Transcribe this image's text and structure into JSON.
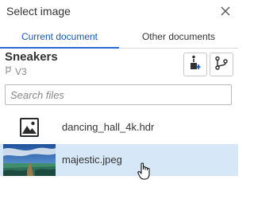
{
  "dialog": {
    "title": "Select image"
  },
  "tabs": [
    {
      "label": "Current document"
    },
    {
      "label": "Other documents"
    }
  ],
  "document": {
    "name": "Sneakers",
    "version": "V3"
  },
  "search": {
    "placeholder": "Search files",
    "value": ""
  },
  "files": [
    {
      "name": "dancing_hall_4k.hdr",
      "icon": "image-icon"
    },
    {
      "name": "majestic.jpeg",
      "icon": "image-thumbnail"
    }
  ],
  "colors": {
    "accent": "#1a57b8",
    "tab_underline": "#2a6ad2",
    "selected_row": "#d6e8f8",
    "border": "#c8c8c8"
  }
}
